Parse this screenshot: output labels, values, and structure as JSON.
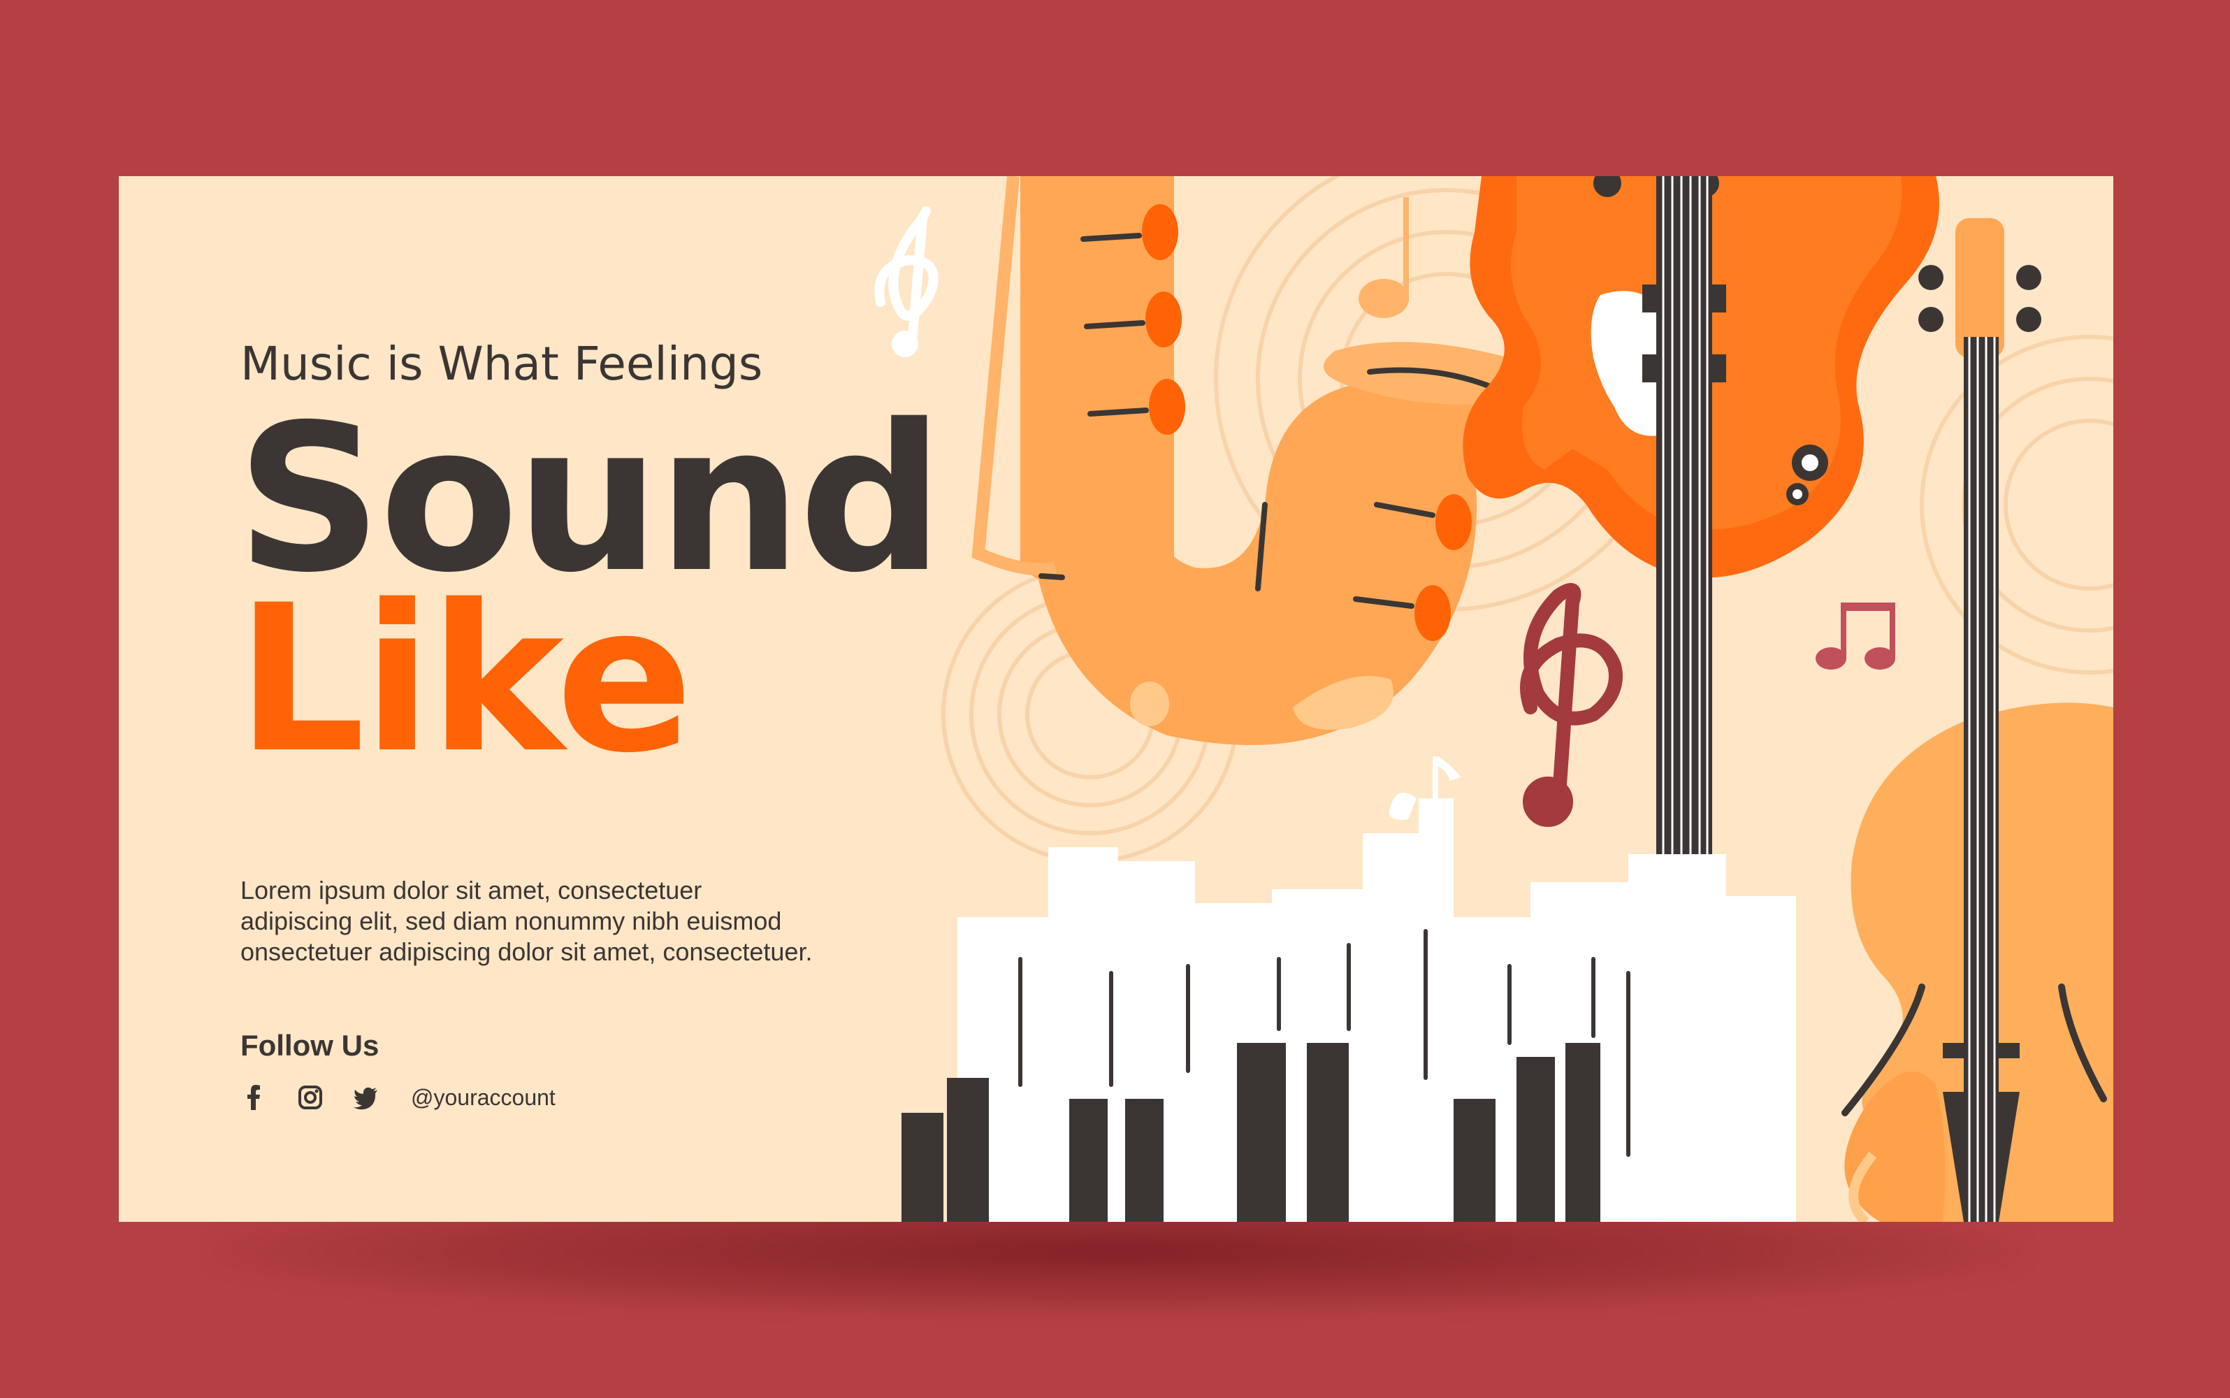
{
  "banner": {
    "subtitle": "Music is What Feelings",
    "headline_line1": "Sound",
    "headline_line2": "Like",
    "body_lines": [
      "Lorem ipsum dolor sit amet, consectetuer",
      "adipiscing elit, sed diam nonummy nibh euismod",
      "onsectetuer adipiscing dolor sit amet, consectetuer."
    ],
    "follow_label": "Follow Us",
    "social_icons": [
      "facebook-icon",
      "instagram-icon",
      "twitter-icon"
    ],
    "handle": "@youraccount"
  },
  "colors": {
    "frame_background": "#B44044",
    "banner_background": "#FEE6C7",
    "dark_text": "#3B3634",
    "accent_orange": "#FF6306",
    "saxophone": "#FFA755",
    "guitar": "#FF6A10",
    "violin": "#FFAE5C",
    "treble_clef": "#A33A3E"
  },
  "illustration_elements": [
    "saxophone",
    "electric-guitar",
    "violin",
    "piano-keys",
    "treble-clef",
    "music-notes"
  ]
}
